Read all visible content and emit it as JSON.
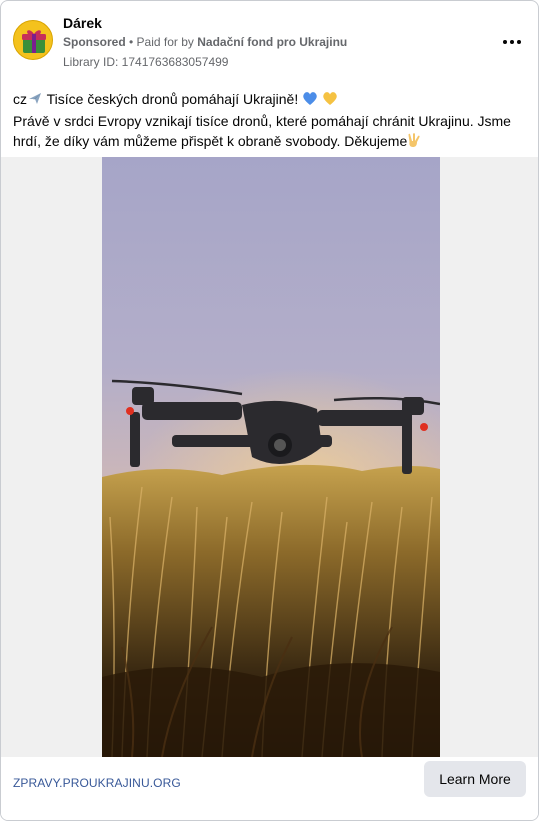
{
  "ad": {
    "page_name": "Dárek",
    "sponsored": "Sponsored",
    "paid_for_prefix": " • Paid for by ",
    "funder": "Nadační fond pro Ukrajinu",
    "library_id": "Library ID: 1741763683057499"
  },
  "post": {
    "line1_prefix": "cz",
    "line1_text": " Tisíce českých dronů pomáhají Ukrajině! ",
    "line2_text": "Právě v srdci Evropy vznikají tisíce dronů, které pomáhají chránit Ukrajinu. Jsme hrdí, že díky vám můžeme přispět k obraně svobody. Děkujeme"
  },
  "cta": {
    "link": "ZPRAVY.PROUKRAJINU.ORG",
    "button": "Learn More"
  },
  "icons": [
    "gift-icon",
    "airplane-emoji-icon",
    "blue-heart-emoji-icon",
    "yellow-heart-emoji-icon",
    "victory-hand-emoji-icon",
    "more-options-icon"
  ],
  "colors": {
    "accent_link": "#385898",
    "button_bg": "#e4e6eb",
    "avatar_bg": "#f4c21d"
  }
}
